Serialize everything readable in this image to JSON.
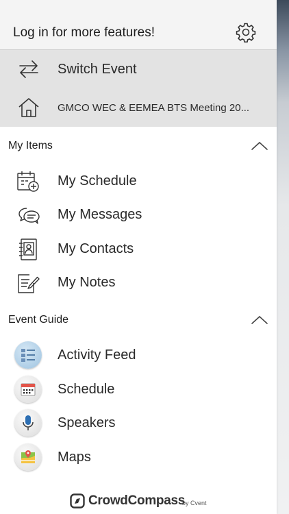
{
  "header": {
    "login_text": "Log in for more features!"
  },
  "top_actions": [
    {
      "label": "Switch Event",
      "icon": "switch-arrows-icon"
    },
    {
      "label": "GMCO WEC & EEMEA BTS Meeting 20...",
      "icon": "home-icon"
    }
  ],
  "my_items": {
    "title": "My Items",
    "items": [
      {
        "label": "My Schedule",
        "icon": "calendar-add-icon"
      },
      {
        "label": "My Messages",
        "icon": "chat-bubbles-icon"
      },
      {
        "label": "My Contacts",
        "icon": "contact-book-icon"
      },
      {
        "label": "My Notes",
        "icon": "note-edit-icon"
      }
    ]
  },
  "event_guide": {
    "title": "Event Guide",
    "items": [
      {
        "label": "Activity Feed",
        "icon": "activity-feed-icon"
      },
      {
        "label": "Schedule",
        "icon": "calendar-icon"
      },
      {
        "label": "Speakers",
        "icon": "microphone-icon"
      },
      {
        "label": "Maps",
        "icon": "map-icon"
      }
    ]
  },
  "footer": {
    "brand": "CrowdCompass",
    "byline": "by Cvent"
  },
  "colors": {
    "grey_band": "#e3e3e3",
    "header_bg": "#f4f4f4",
    "text": "#2a2a2a"
  }
}
